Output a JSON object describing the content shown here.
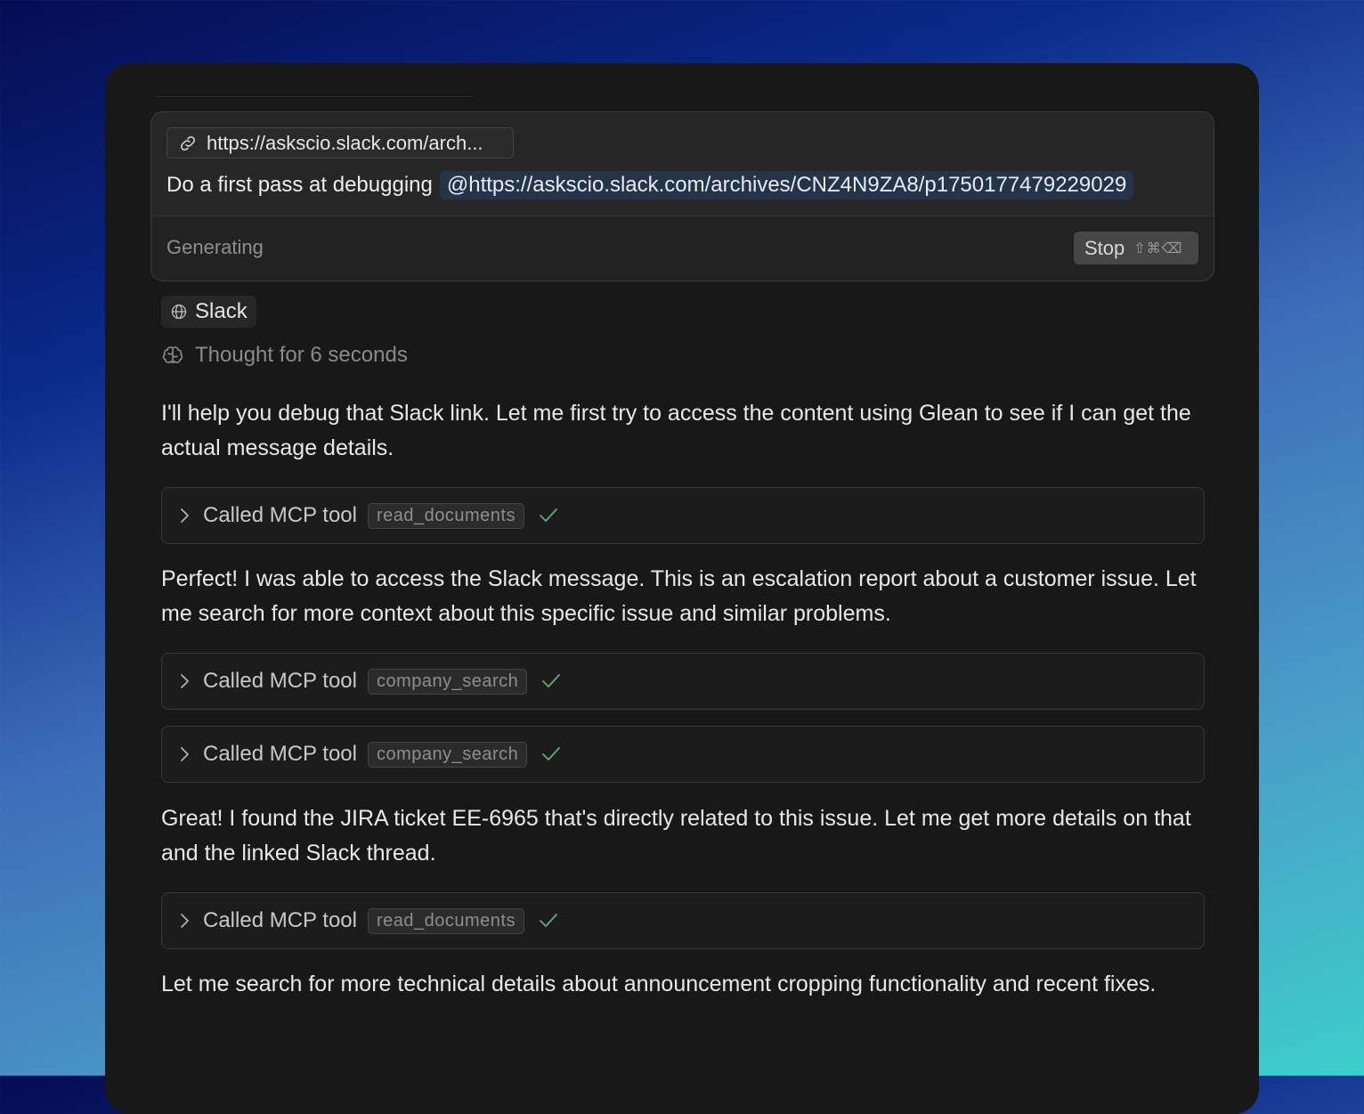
{
  "composer": {
    "attachment_label": "https://askscio.slack.com/arch...",
    "prompt_text": "Do a first pass at debugging",
    "mention_text": "@https://askscio.slack.com/archives/CNZ4N9ZA8/p1750177479229029",
    "status": "Generating",
    "stop_label": "Stop",
    "stop_shortcut": "⇧⌘⌫"
  },
  "source_pill": {
    "label": "Slack",
    "icon": "globe-icon"
  },
  "thought": {
    "label": "Thought for 6 seconds",
    "icon": "brain-icon"
  },
  "messages": [
    "I'll help you debug that Slack link. Let me first try to access the content using Glean to see if I can get the actual message details.",
    "Perfect! I was able to access the Slack message. This is an escalation report about a customer issue. Let me search for more context about this specific issue and similar problems.",
    "Great! I found the JIRA ticket EE-6965 that's directly related to this issue. Let me get more details on that and the linked Slack thread.",
    "Let me search for more technical details about announcement cropping functionality and recent fixes."
  ],
  "tool_calls": [
    {
      "label": "Called MCP tool",
      "tool": "read_documents",
      "status": "done"
    },
    {
      "label": "Called MCP tool",
      "tool": "company_search",
      "status": "done"
    },
    {
      "label": "Called MCP tool",
      "tool": "company_search",
      "status": "done"
    },
    {
      "label": "Called MCP tool",
      "tool": "read_documents",
      "status": "done"
    }
  ],
  "colors": {
    "check": "#5fae7a",
    "mention_bg": "#26344a",
    "panel_bg": "#181818"
  }
}
